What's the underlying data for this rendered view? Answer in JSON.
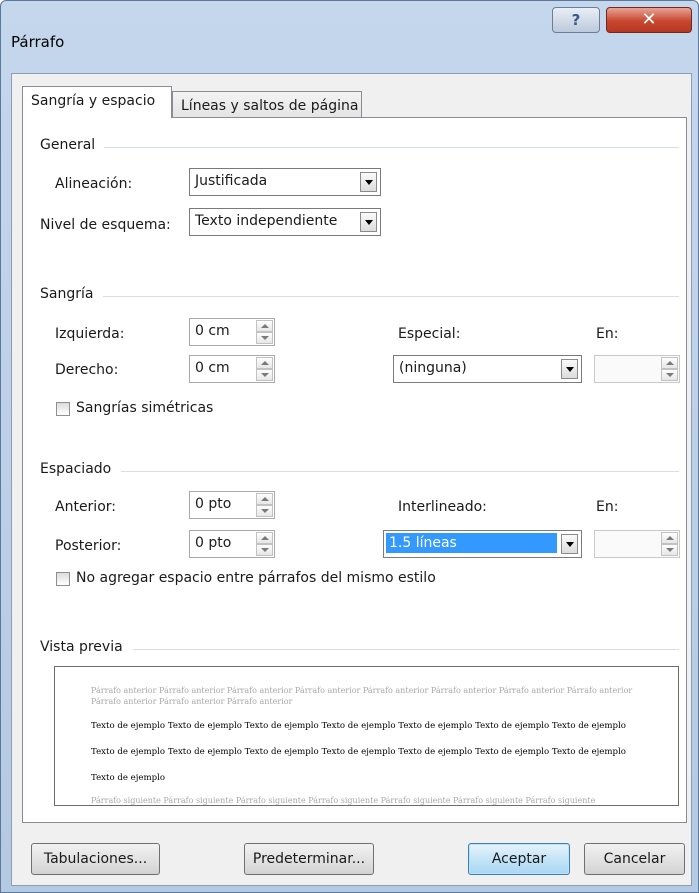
{
  "window": {
    "title": "Párrafo",
    "help_label": "?",
    "close_label": "✕"
  },
  "tabs": [
    {
      "label": "Sangría y espacio",
      "active": true
    },
    {
      "label": "Líneas y saltos de página",
      "active": false
    }
  ],
  "general": {
    "heading": "General",
    "alignment_label": "Alineación:",
    "alignment_value": "Justificada",
    "outline_label": "Nivel de esquema:",
    "outline_value": "Texto independiente"
  },
  "indent": {
    "heading": "Sangría",
    "left_label": "Izquierda:",
    "left_value": "0 cm",
    "right_label": "Derecho:",
    "right_value": "0 cm",
    "special_label": "Especial:",
    "special_value": "(ninguna)",
    "by_label": "En:",
    "by_value": "",
    "mirror_label": "Sangrías simétricas",
    "mirror_checked": false
  },
  "spacing": {
    "heading": "Espaciado",
    "before_label": "Anterior:",
    "before_value": "0 pto",
    "after_label": "Posterior:",
    "after_value": "0 pto",
    "line_label": "Interlineado:",
    "line_value": "1.5 líneas",
    "at_label": "En:",
    "at_value": "",
    "no_space_label": "No agregar espacio entre párrafos del mismo estilo",
    "no_space_checked": false
  },
  "preview": {
    "heading": "Vista previa",
    "previous_text": "Párrafo anterior Párrafo anterior Párrafo anterior Párrafo anterior Párrafo anterior Párrafo anterior Párrafo anterior Párrafo anterior Párrafo anterior Párrafo anterior Párrafo anterior",
    "sample_text": "Texto de ejemplo Texto de ejemplo Texto de ejemplo Texto de ejemplo Texto de ejemplo Texto de ejemplo Texto de ejemplo Texto de ejemplo Texto de ejemplo Texto de ejemplo Texto de ejemplo Texto de ejemplo Texto de ejemplo Texto de ejemplo Texto de ejemplo",
    "next_text": "Párrafo siguiente Párrafo siguiente Párrafo siguiente Párrafo siguiente Párrafo siguiente Párrafo siguiente Párrafo siguiente"
  },
  "buttons": {
    "tabs": "Tabulaciones...",
    "default": "Predeterminar...",
    "ok": "Aceptar",
    "cancel": "Cancelar"
  },
  "colors": {
    "selection": "#3399ff",
    "title_bar": "#c5d7ec",
    "close": "#c9472f"
  }
}
